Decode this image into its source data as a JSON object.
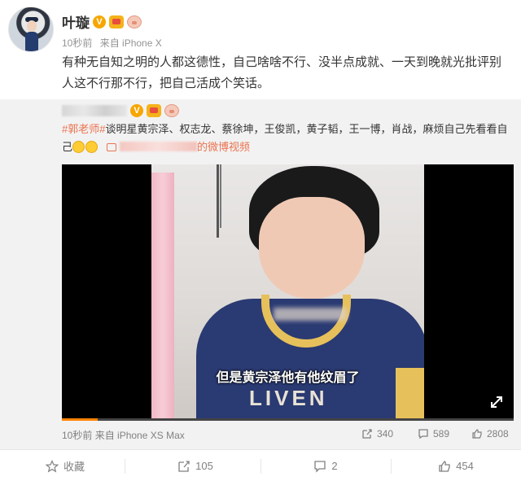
{
  "post": {
    "author": "叶璇",
    "verified_badge": "V",
    "time": "10秒前",
    "source": "来自 iPhone X",
    "text": "有种无自知之明的人都这德性，自己啥啥不行、没半点成就、一天到晚就光批评别人这不行那不行，把自己活成个笑话。"
  },
  "repost": {
    "verified_badge": "V",
    "hashtag": "#郭老师#",
    "text": "谈明星黄宗泽、权志龙、蔡徐坤，王俊凯，黄子韬，王一博，肖战，麻烦自己先看看自己",
    "video_link": "的微博视频",
    "video": {
      "subtitle": "但是黄宗泽他有他纹眉了",
      "shirt_print": "LIVEN",
      "progress": 0.08
    },
    "time": "10秒前",
    "source": "来自 iPhone XS Max",
    "reposts": "340",
    "comments": "589",
    "likes": "2808"
  },
  "actions": {
    "favorite": "收藏",
    "repost": "105",
    "comment": "2",
    "like": "454"
  },
  "colors": {
    "accent": "#eb7350",
    "badge": "#f7a600",
    "progress": "#ff8200"
  }
}
